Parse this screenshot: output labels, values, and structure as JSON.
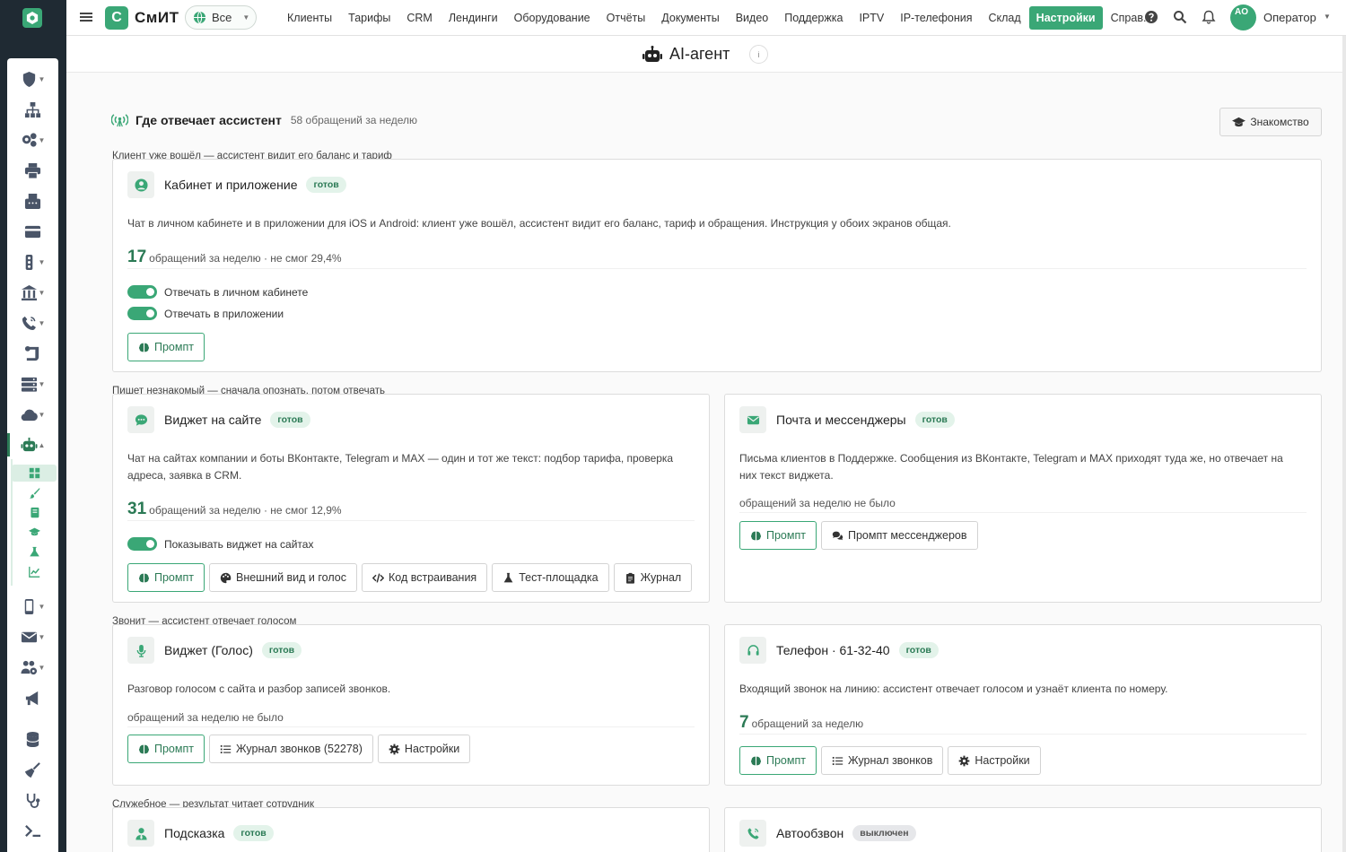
{
  "app": {
    "brand": "СмИТ",
    "brand_letter": "С",
    "scope": "Все"
  },
  "nav": [
    "Клиенты",
    "Тарифы",
    "CRM",
    "Лендинги",
    "Оборудование",
    "Отчёты",
    "Документы",
    "Видео",
    "Поддержка",
    "IPTV",
    "IP-телефония",
    "Склад",
    "Настройки",
    "Справ."
  ],
  "nav_active": "Настройки",
  "user": {
    "initials": "AO",
    "name": "Оператор"
  },
  "page": {
    "title": "AI-агент",
    "info": "i"
  },
  "section": {
    "title": "Где отвечает ассистент",
    "count": "58 обращений за неделю",
    "intro_button": "Знакомство"
  },
  "groups": {
    "logged": "Клиент уже вошёл — ассистент видит его баланс и тариф",
    "stranger": "Пишет незнакомый — сначала опознать, потом отвечать",
    "voice": "Звонит — ассистент отвечает голосом",
    "service": "Служебное — результат читает сотрудник"
  },
  "cards": {
    "cabinet": {
      "title": "Кабинет и приложение",
      "badge": "готов",
      "desc": "Чат в личном кабинете и в приложении для iOS и Android: клиент уже вошёл, ассистент видит его баланс, тариф и обращения. Инструкция у обоих экранов общая.",
      "num": "17",
      "stat": "обращений за неделю · не смог 29,4%",
      "toggles": [
        "Отвечать в личном кабинете",
        "Отвечать в приложении"
      ],
      "buttons": [
        "Промпт"
      ]
    },
    "widget": {
      "title": "Виджет на сайте",
      "badge": "готов",
      "desc": "Чат на сайтах компании и боты ВКонтакте, Telegram и MAX — один и тот же текст: подбор тарифа, проверка адреса, заявка в CRM.",
      "num": "31",
      "stat": "обращений за неделю · не смог 12,9%",
      "toggles": [
        "Показывать виджет на сайтах"
      ],
      "buttons": [
        "Промпт",
        "Внешний вид и голос",
        "Код встраивания",
        "Тест-площадка",
        "Журнал"
      ]
    },
    "mail": {
      "title": "Почта и мессенджеры",
      "badge": "готов",
      "desc": "Письма клиентов в Поддержке. Сообщения из ВКонтакте, Telegram и MAX приходят туда же, но отвечает на них текст виджета.",
      "stat": "обращений за неделю не было",
      "buttons": [
        "Промпт",
        "Промпт мессенджеров"
      ]
    },
    "voice": {
      "title": "Виджет (Голос)",
      "badge": "готов",
      "desc": "Разговор голосом с сайта и разбор записей звонков.",
      "stat": "обращений за неделю не было",
      "buttons": [
        "Промпт",
        "Журнал звонков (52278)",
        "Настройки"
      ]
    },
    "phone": {
      "title": "Телефон · 61-32-40",
      "badge": "готов",
      "desc": "Входящий звонок на линию: ассистент отвечает голосом и узнаёт клиента по номеру.",
      "num": "7",
      "stat": "обращений за неделю",
      "buttons": [
        "Промпт",
        "Журнал звонков",
        "Настройки"
      ]
    },
    "hint": {
      "title": "Подсказка",
      "badge": "готов"
    },
    "autocall": {
      "title": "Автообзвон",
      "badge": "выключен"
    }
  }
}
